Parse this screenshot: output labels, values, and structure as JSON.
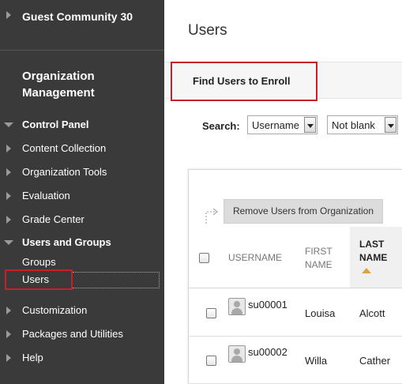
{
  "sidebar": {
    "community": "Guest Community 30",
    "org_title_line1": "Organization",
    "org_title_line2": "Management",
    "control_panel": "Control Panel",
    "items": [
      {
        "label": "Content Collection"
      },
      {
        "label": "Organization Tools"
      },
      {
        "label": "Evaluation"
      },
      {
        "label": "Grade Center"
      }
    ],
    "users_and_groups": "Users and Groups",
    "sub_items": {
      "groups": "Groups",
      "users": "Users"
    },
    "bottom_items": [
      {
        "label": "Customization"
      },
      {
        "label": "Packages and Utilities"
      },
      {
        "label": "Help"
      }
    ]
  },
  "main": {
    "title": "Users",
    "find_button": "Find Users to Enroll",
    "search": {
      "label": "Search:",
      "field_value": "Username",
      "operator_value": "Not blank"
    },
    "remove_button": "Remove Users from Organization",
    "columns": {
      "username": "USERNAME",
      "first_name_line1": "FIRST",
      "first_name_line2": "NAME",
      "last_name_line1": "LAST",
      "last_name_line2": "NAME"
    },
    "rows": [
      {
        "username": "su00001",
        "first": "Louisa",
        "last": "Alcott"
      },
      {
        "username": "su00002",
        "first": "Willa",
        "last": "Cather"
      }
    ]
  },
  "colors": {
    "sidebar_bg": "#3a3a3a",
    "highlight_red": "#c62128",
    "sort_indicator": "#d9a441"
  }
}
